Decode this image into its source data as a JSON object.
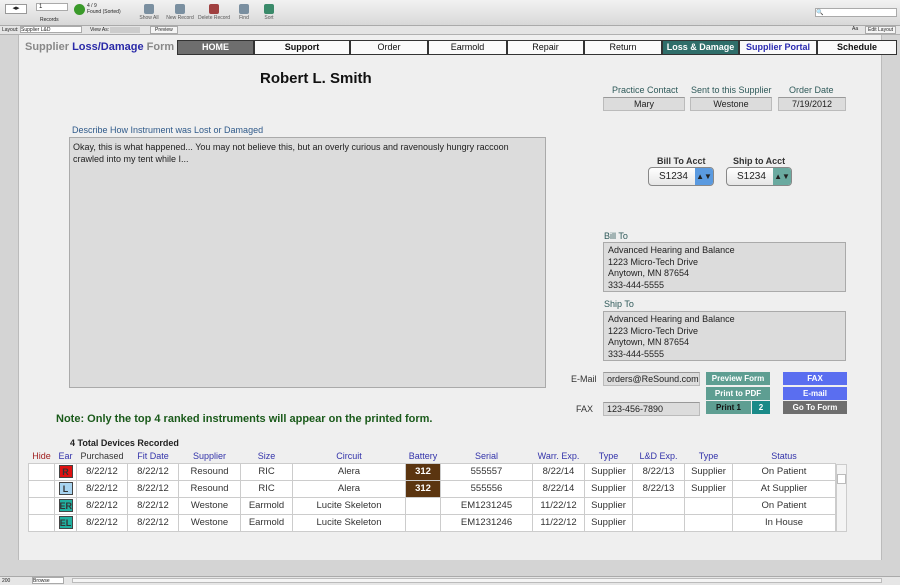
{
  "toolbar": {
    "record_number": "1",
    "records_label": "Records",
    "found_count": "4 / 9",
    "found_label": "Found (Sorted)",
    "show_all": "Show All",
    "new_record": "New Record",
    "delete_record": "Delete Record",
    "find": "Find",
    "sort": "Sort"
  },
  "layoutbar": {
    "layout_label": "Layout:",
    "layout_value": "Supplier L&D",
    "view_as_label": "View As:",
    "preview": "Preview",
    "aa": "Aa",
    "edit_layout": "Edit Layout"
  },
  "form": {
    "title_pre": "Supplier ",
    "title_hl": "Loss/Damage",
    "title_post": " Form"
  },
  "nav": [
    {
      "label": "HOME"
    },
    {
      "label": "Support"
    },
    {
      "label": "Order"
    },
    {
      "label": "Earmold"
    },
    {
      "label": "Repair"
    },
    {
      "label": "Return"
    },
    {
      "label": "Loss & Damage"
    },
    {
      "label": "Supplier Portal"
    },
    {
      "label": "Schedule"
    }
  ],
  "patient_name": "Robert L. Smith",
  "practice_contact": {
    "label": "Practice Contact",
    "value": "Mary"
  },
  "sent_to": {
    "label": "Sent to this Supplier",
    "value": "Westone"
  },
  "order_date": {
    "label": "Order Date",
    "value": "7/19/2012"
  },
  "describe": {
    "label": "Describe How Instrument was Lost or Damaged",
    "value": "Okay, this is what happened... You may not believe this, but an overly curious and ravenously hungry raccoon crawled into my tent while I..."
  },
  "bill_acct": {
    "label": "Bill To Acct",
    "value": "S1234"
  },
  "ship_acct": {
    "label": "Ship to Acct",
    "value": "S1234"
  },
  "bill_to": {
    "label": "Bill To",
    "lines": [
      "Advanced Hearing and Balance",
      "1223 Micro-Tech Drive",
      "Anytown, MN 87654",
      "333-444-5555"
    ]
  },
  "ship_to": {
    "label": "Ship To",
    "lines": [
      "Advanced Hearing and Balance",
      "1223 Micro-Tech Drive",
      "Anytown, MN 87654",
      "333-444-5555"
    ]
  },
  "email": {
    "label": "E-Mail",
    "value": "orders@ReSound.com"
  },
  "fax": {
    "label": "FAX",
    "value": "123-456-7890"
  },
  "buttons": {
    "preview_form": "Preview Form",
    "print_pdf": "Print to PDF",
    "print1": "Print 1",
    "print2": "2",
    "fax": "FAX",
    "email": "E-mail",
    "go_to_form": "Go To Form"
  },
  "note": "Note: Only the top 4 ranked instruments will appear on the printed form.",
  "devices_count": "4 Total Devices Recorded",
  "table": {
    "headers": [
      "Hide",
      "Ear",
      "Purchased",
      "Fit Date",
      "Supplier",
      "Size",
      "Circuit",
      "Battery",
      "Serial",
      "Warr. Exp.",
      "Type",
      "L&D  Exp.",
      "Type",
      "Status"
    ],
    "rows": [
      [
        "",
        "R",
        "8/22/12",
        "8/22/12",
        "Resound",
        "RIC",
        "Alera",
        "312",
        "555557",
        "8/22/14",
        "Supplier",
        "8/22/13",
        "Supplier",
        "On Patient"
      ],
      [
        "",
        "L",
        "8/22/12",
        "8/22/12",
        "Resound",
        "RIC",
        "Alera",
        "312",
        "555556",
        "8/22/14",
        "Supplier",
        "8/22/13",
        "Supplier",
        "At Supplier"
      ],
      [
        "",
        "ER",
        "8/22/12",
        "8/22/12",
        "Westone",
        "Earmold",
        "Lucite Skeleton",
        "",
        "EM1231245",
        "11/22/12",
        "Supplier",
        "",
        "",
        "On Patient"
      ],
      [
        "",
        "EL",
        "8/22/12",
        "8/22/12",
        "Westone",
        "Earmold",
        "Lucite Skeleton",
        "",
        "EM1231246",
        "11/22/12",
        "Supplier",
        "",
        "",
        "In House"
      ]
    ]
  },
  "ear_colors": {
    "R": "#e01010",
    "L": "#a8d4f0",
    "ER": "#20b0a0",
    "EL": "#20b0a0"
  },
  "statusbar": {
    "zoom": "200",
    "mode": "Browse"
  }
}
